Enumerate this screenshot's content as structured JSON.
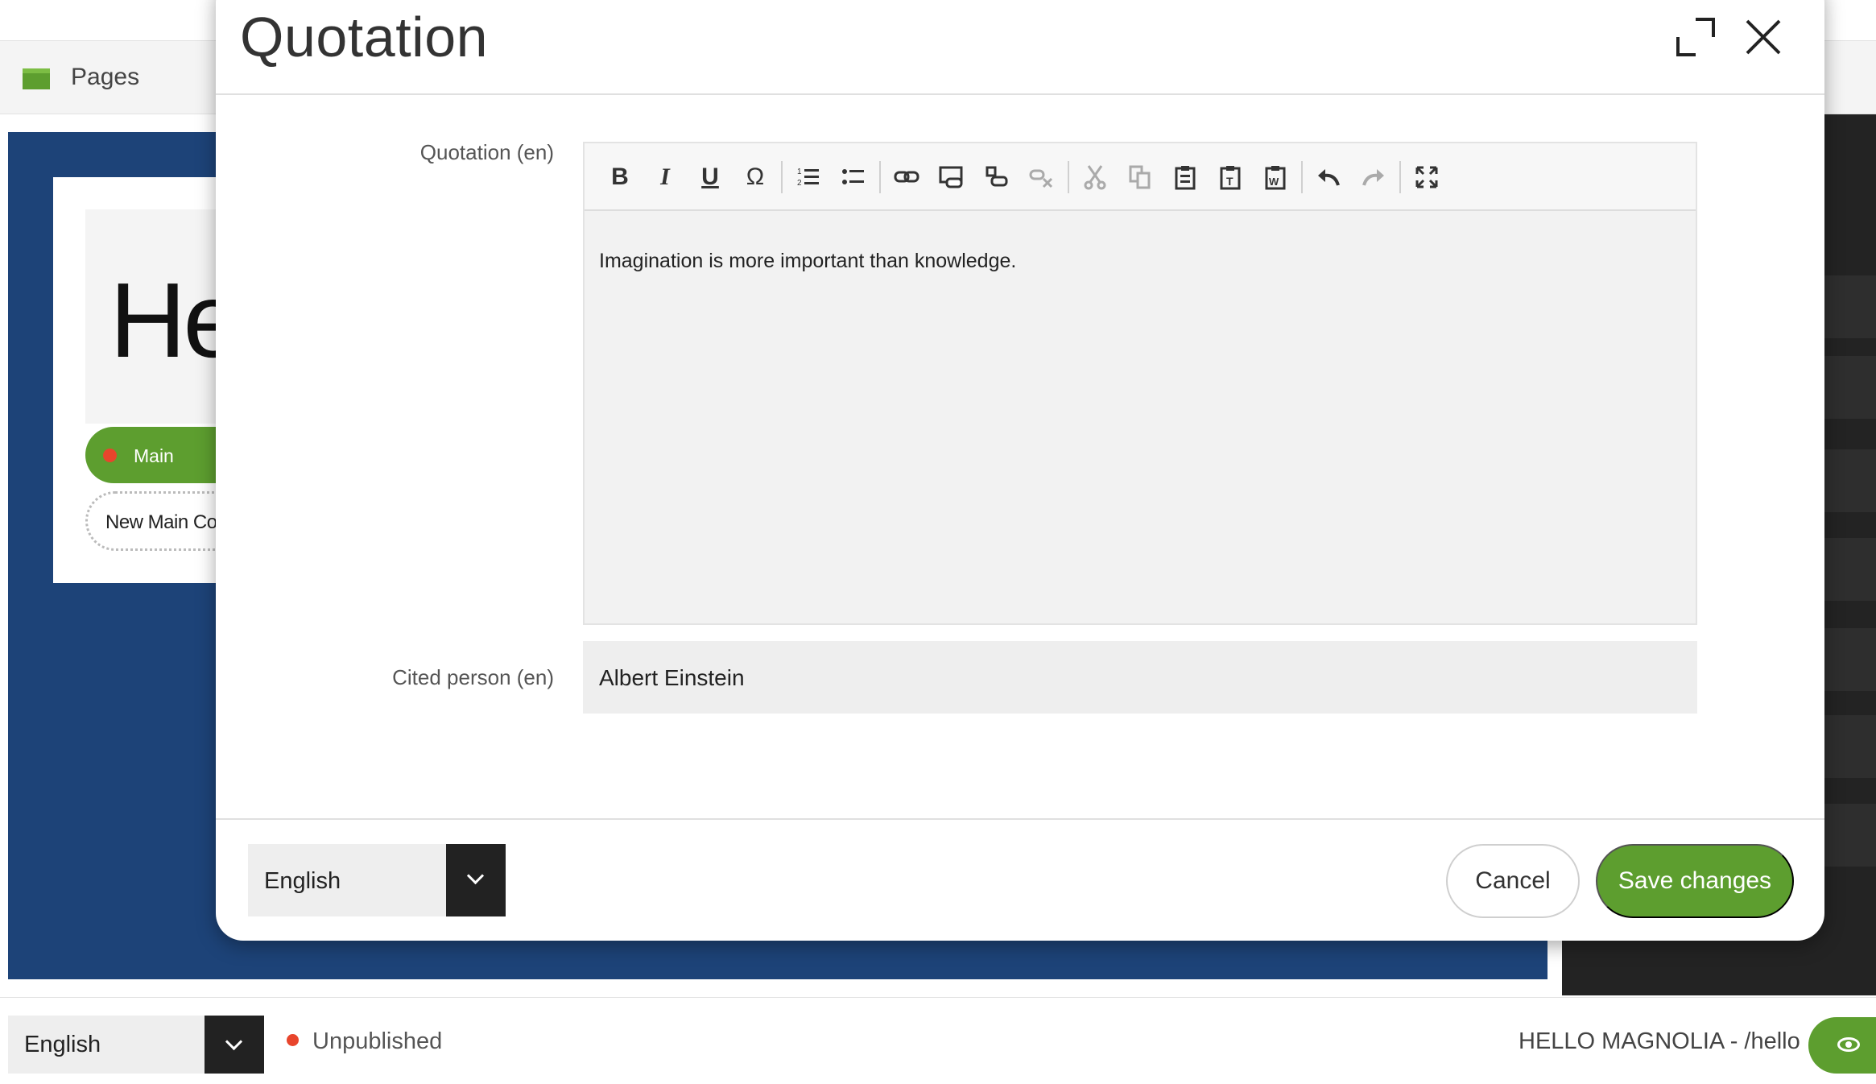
{
  "app": {
    "title": "Pages",
    "page_hero_text": "He",
    "area_label": "Main",
    "new_component_label": "New Main Co"
  },
  "statusbar": {
    "language": "English",
    "publish_status": "Unpublished",
    "page_path": "HELLO MAGNOLIA - /hello"
  },
  "dialog": {
    "title": "Quotation",
    "fields": {
      "quotation_label": "Quotation (en)",
      "quotation_text": "Imagination is more important than knowledge.",
      "cited_person_label": "Cited person (en)",
      "cited_person_value": "Albert Einstein"
    },
    "toolbar": {
      "bold": "B",
      "italic": "I",
      "underline": "U",
      "special_char": "Ω",
      "buttons": [
        "bold",
        "italic",
        "underline",
        "special-character",
        "numbered-list",
        "bulleted-list",
        "link",
        "internal-link",
        "anchor",
        "unlink",
        "cut",
        "copy",
        "paste",
        "paste-as-text",
        "paste-from-word",
        "undo",
        "redo",
        "maximize"
      ]
    },
    "footer": {
      "language": "English",
      "cancel": "Cancel",
      "save": "Save changes"
    }
  },
  "colors": {
    "accent_green": "#5d9e2f",
    "canvas_blue": "#1d4378",
    "status_red": "#e8452c",
    "dark_panel": "#232323"
  }
}
